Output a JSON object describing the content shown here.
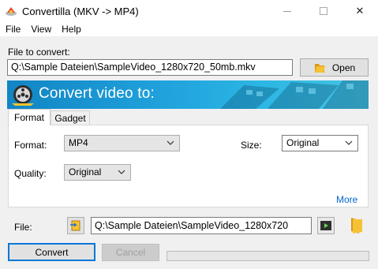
{
  "window": {
    "title": "Convertilla  (MKV -> MP4)",
    "minimize_icon": "minimize-icon",
    "maximize_icon": "maximize-icon",
    "close_glyph": "✕"
  },
  "menu": {
    "items": [
      "File",
      "View",
      "Help"
    ]
  },
  "source": {
    "label": "File to convert:",
    "path": "Q:\\Sample Dateien\\SampleVideo_1280x720_50mb.mkv",
    "open_label": "Open",
    "open_icon": "folder-open-icon"
  },
  "banner": {
    "title": "Convert video to:",
    "icon": "film-reel-icon"
  },
  "tabs": {
    "format_label": "Format",
    "gadget_label": "Gadget",
    "active": "Format"
  },
  "format_panel": {
    "format_label": "Format:",
    "format_value": "MP4",
    "size_label": "Size:",
    "size_value": "Original",
    "quality_label": "Quality:",
    "quality_value": "Original",
    "more_label": "More"
  },
  "output": {
    "label": "File:",
    "path": "Q:\\Sample Dateien\\SampleVideo_1280x720",
    "set_icon": "output-file-icon",
    "play_icon": "play-icon",
    "folder_icon": "folder-icon"
  },
  "actions": {
    "convert_label": "Convert",
    "cancel_label": "Cancel",
    "progress": 0
  },
  "colors": {
    "banner": "#1d9ad6",
    "accent": "#0078d7",
    "link": "#0066cc"
  }
}
